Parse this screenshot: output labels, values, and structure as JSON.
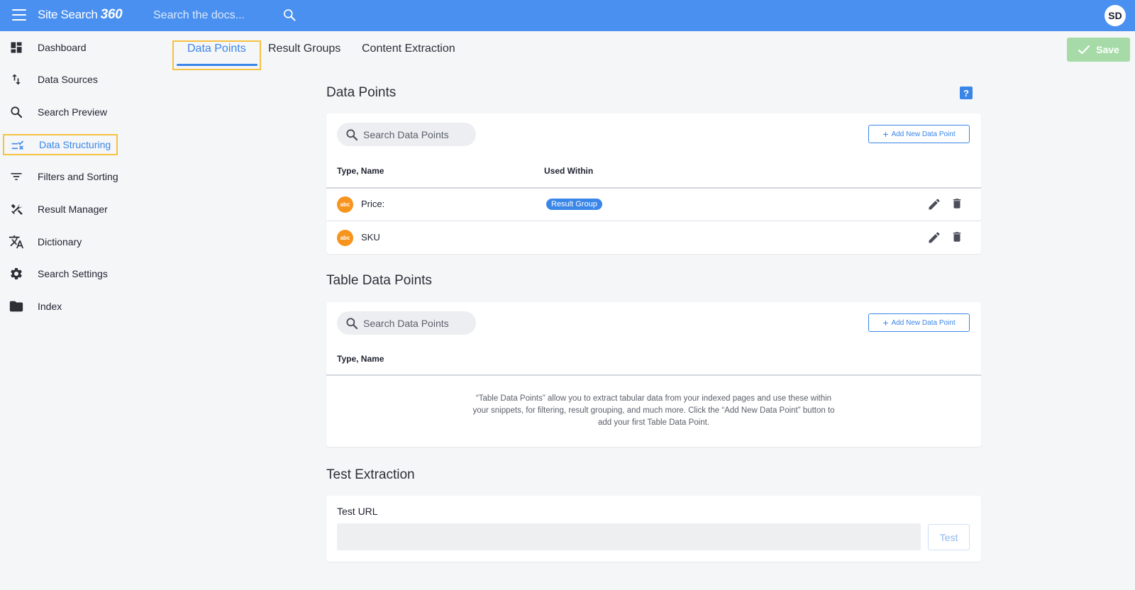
{
  "topbar": {
    "logo_text": "Site Search",
    "logo_suffix": "360",
    "search_placeholder": "Search the docs...",
    "avatar_initials": "SD"
  },
  "sidebar": {
    "items": [
      {
        "label": "Dashboard",
        "icon": "dashboard-icon"
      },
      {
        "label": "Data Sources",
        "icon": "swap-vertical-icon"
      },
      {
        "label": "Search Preview",
        "icon": "search-icon"
      },
      {
        "label": "Data Structuring",
        "icon": "data-structuring-icon",
        "active": true
      },
      {
        "label": "Filters and Sorting",
        "icon": "filter-icon"
      },
      {
        "label": "Result Manager",
        "icon": "tools-icon"
      },
      {
        "label": "Dictionary",
        "icon": "translate-icon"
      },
      {
        "label": "Search Settings",
        "icon": "gear-icon"
      },
      {
        "label": "Index",
        "icon": "folder-icon"
      }
    ]
  },
  "tabs": [
    {
      "label": "Data Points",
      "active": true
    },
    {
      "label": "Result Groups"
    },
    {
      "label": "Content Extraction"
    }
  ],
  "save_label": "Save",
  "data_points": {
    "title": "Data Points",
    "help": "?",
    "search_placeholder": "Search Data Points",
    "add_label": "Add New Data Point",
    "col_type_name": "Type, Name",
    "col_used_within": "Used Within",
    "rows": [
      {
        "type_icon": "abc",
        "name": "Price:",
        "used_within": "Result Group"
      },
      {
        "type_icon": "abc",
        "name": "SKU",
        "used_within": ""
      }
    ]
  },
  "table_data_points": {
    "title": "Table Data Points",
    "search_placeholder": "Search Data Points",
    "add_label": "Add New Data Point",
    "col_type_name": "Type, Name",
    "empty_message": "“Table Data Points” allow you to extract tabular data from your indexed pages and use these within your snippets, for filtering, result grouping, and much more. Click the “Add New Data Point” button to add your first Table Data Point."
  },
  "test_extraction": {
    "title": "Test Extraction",
    "url_label": "Test URL",
    "url_value": "",
    "test_label": "Test"
  },
  "colors": {
    "topbar": "#4a90f0",
    "accent": "#3a86e8",
    "highlight": "#f5c242",
    "type_badge": "#f7941d",
    "save_disabled": "#a6dba8"
  }
}
